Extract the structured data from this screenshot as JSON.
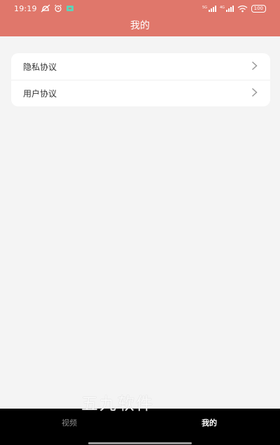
{
  "status_bar": {
    "time": "19:19",
    "battery": "100",
    "signal_1": "5G",
    "signal_2": "4G"
  },
  "header": {
    "title": "我的"
  },
  "menu": {
    "items": [
      {
        "label": "隐私协议"
      },
      {
        "label": "用户协议"
      }
    ]
  },
  "tabbar": {
    "tabs": [
      {
        "label": "视频",
        "active": false
      },
      {
        "label": "我的",
        "active": true
      }
    ]
  },
  "watermark": "五九软件",
  "colors": {
    "header_bg": "#e0776b",
    "page_bg": "#f4f4f4",
    "tabbar_bg": "#000000",
    "active_tab": "#ffffff",
    "inactive_tab": "#8c8c8c"
  },
  "icons": {
    "row_arrow": "chevron-right-icon"
  }
}
